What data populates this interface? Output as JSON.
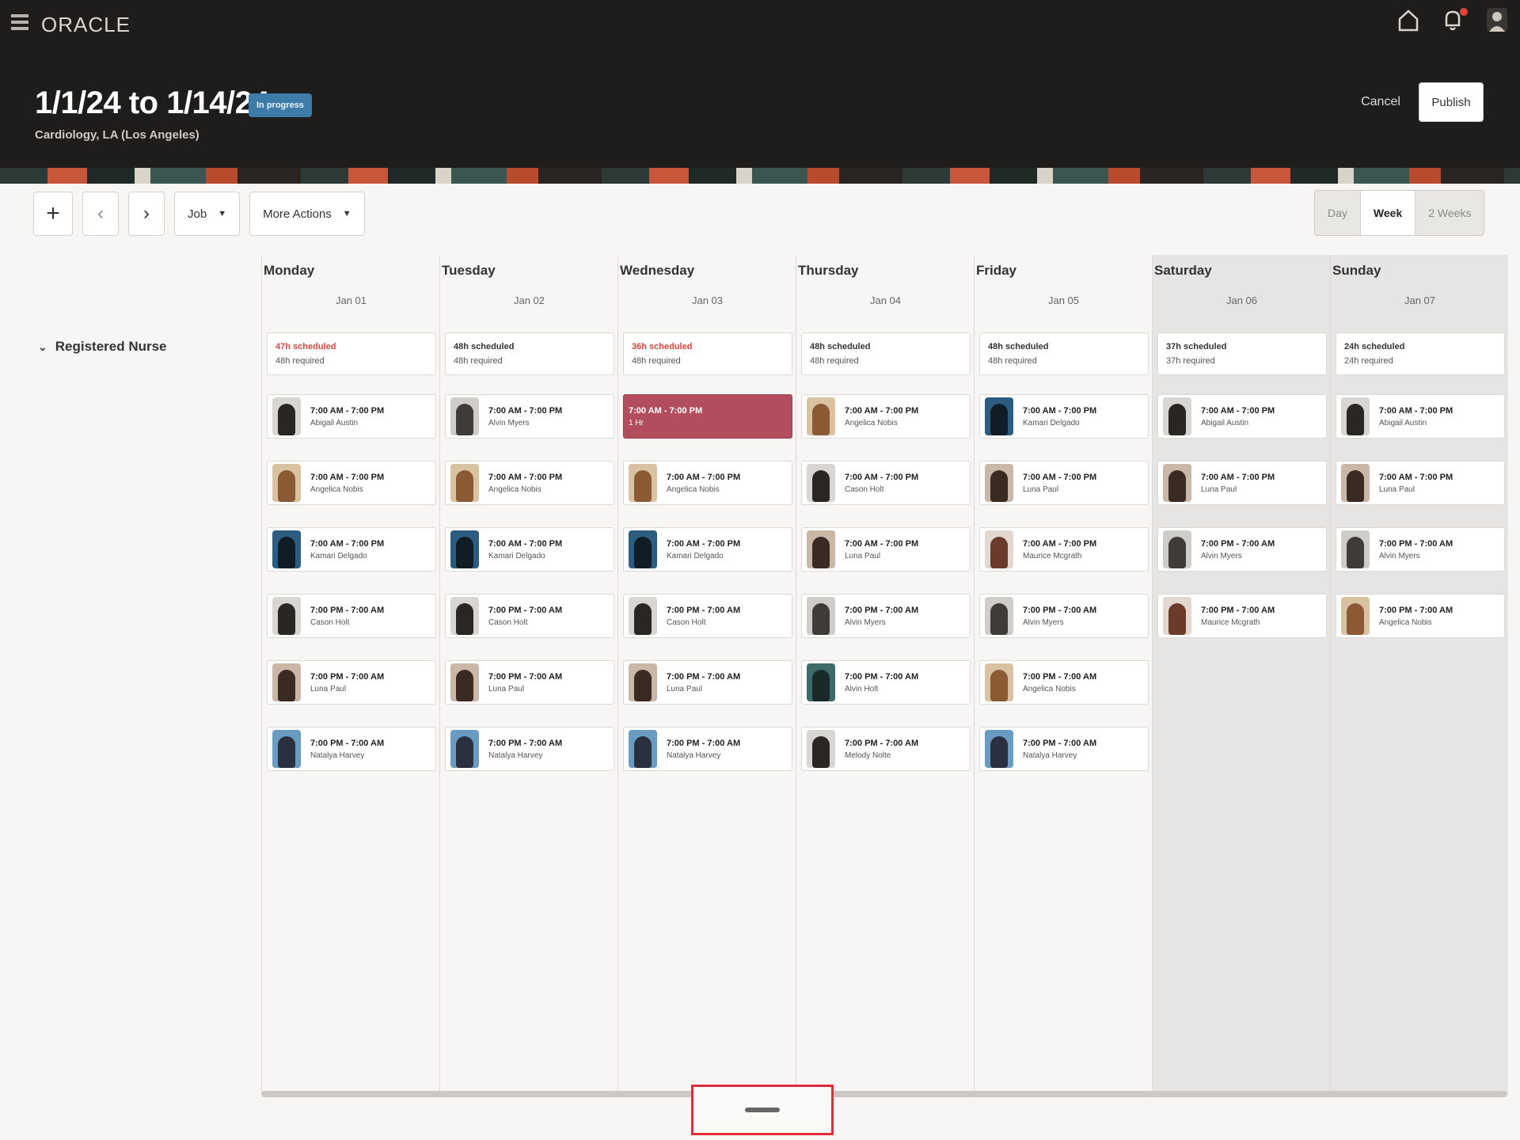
{
  "header": {
    "logo": "ORACLE",
    "title": "1/1/24 to 1/14/24",
    "status": "In progress",
    "subtitle": "Cardiology, LA (Los Angeles)",
    "cancel_label": "Cancel",
    "publish_label": "Publish",
    "icons": [
      "menu-icon",
      "home-icon",
      "notifications-icon",
      "user-avatar"
    ]
  },
  "toolbar": {
    "add_label": "+",
    "prev_label": "‹",
    "next_label": "›",
    "job_label": "Job",
    "more_actions_label": "More Actions",
    "views": [
      "Day",
      "Week",
      "2 Weeks"
    ],
    "active_view": "Week"
  },
  "group": {
    "label": "Registered Nurse"
  },
  "days": [
    {
      "name": "Monday",
      "date": "Jan 01",
      "scheduled": "47h scheduled",
      "required": "48h required",
      "warn": true,
      "weekend": false
    },
    {
      "name": "Tuesday",
      "date": "Jan 02",
      "scheduled": "48h scheduled",
      "required": "48h required",
      "warn": false,
      "weekend": false
    },
    {
      "name": "Wednesday",
      "date": "Jan 03",
      "scheduled": "36h scheduled",
      "required": "48h required",
      "warn": true,
      "weekend": false
    },
    {
      "name": "Thursday",
      "date": "Jan 04",
      "scheduled": "48h scheduled",
      "required": "48h required",
      "warn": false,
      "weekend": false
    },
    {
      "name": "Friday",
      "date": "Jan 05",
      "scheduled": "48h scheduled",
      "required": "48h required",
      "warn": false,
      "weekend": false
    },
    {
      "name": "Saturday",
      "date": "Jan 06",
      "scheduled": "37h scheduled",
      "required": "37h required",
      "warn": false,
      "weekend": true
    },
    {
      "name": "Sunday",
      "date": "Jan 07",
      "scheduled": "24h scheduled",
      "required": "24h required",
      "warn": false,
      "weekend": true
    }
  ],
  "shifts": [
    [
      {
        "time": "7:00 AM - 7:00 PM",
        "person": "Abigail Austin",
        "avatar": "dark"
      },
      {
        "time": "7:00 AM - 7:00 PM",
        "person": "Angelica Nobis",
        "avatar": "warm"
      },
      {
        "time": "7:00 AM - 7:00 PM",
        "person": "Kamari Delgado",
        "avatar": "blue"
      },
      {
        "time": "7:00 PM - 7:00 AM",
        "person": "Cason Holt",
        "avatar": "dark"
      },
      {
        "time": "7:00 PM - 7:00 AM",
        "person": "Luna Paul",
        "avatar": "brown"
      },
      {
        "time": "7:00 PM - 7:00 AM",
        "person": "Natalya Harvey",
        "avatar": "navy"
      }
    ],
    [
      {
        "time": "7:00 AM - 7:00 PM",
        "person": "Alvin Myers",
        "avatar": "grey"
      },
      {
        "time": "7:00 AM - 7:00 PM",
        "person": "Angelica Nobis",
        "avatar": "warm"
      },
      {
        "time": "7:00 AM - 7:00 PM",
        "person": "Kamari Delgado",
        "avatar": "blue"
      },
      {
        "time": "7:00 PM - 7:00 AM",
        "person": "Cason Holt",
        "avatar": "dark"
      },
      {
        "time": "7:00 PM - 7:00 AM",
        "person": "Luna Paul",
        "avatar": "brown"
      },
      {
        "time": "7:00 PM - 7:00 AM",
        "person": "Natalya Harvey",
        "avatar": "navy"
      }
    ],
    [
      {
        "time": "7:00 AM - 7:00 PM",
        "person": "1 Hr",
        "avatar": "",
        "open": true
      },
      {
        "time": "7:00 AM - 7:00 PM",
        "person": "Angelica Nobis",
        "avatar": "warm"
      },
      {
        "time": "7:00 AM - 7:00 PM",
        "person": "Kamari Delgado",
        "avatar": "blue"
      },
      {
        "time": "7:00 PM - 7:00 AM",
        "person": "Cason Holt",
        "avatar": "dark"
      },
      {
        "time": "7:00 PM - 7:00 AM",
        "person": "Luna Paul",
        "avatar": "brown"
      },
      {
        "time": "7:00 PM - 7:00 AM",
        "person": "Natalya Harvey",
        "avatar": "navy"
      }
    ],
    [
      {
        "time": "7:00 AM - 7:00 PM",
        "person": "Angelica Nobis",
        "avatar": "warm"
      },
      {
        "time": "7:00 AM - 7:00 PM",
        "person": "Cason Holt",
        "avatar": "dark"
      },
      {
        "time": "7:00 AM - 7:00 PM",
        "person": "Luna Paul",
        "avatar": "brown"
      },
      {
        "time": "7:00 PM - 7:00 AM",
        "person": "Alvin Myers",
        "avatar": "grey"
      },
      {
        "time": "7:00 PM - 7:00 AM",
        "person": "Alvin Holt",
        "avatar": "teal"
      },
      {
        "time": "7:00 PM - 7:00 AM",
        "person": "Melody Nolte",
        "avatar": "dark"
      }
    ],
    [
      {
        "time": "7:00 AM - 7:00 PM",
        "person": "Kamari Delgado",
        "avatar": "blue"
      },
      {
        "time": "7:00 AM - 7:00 PM",
        "person": "Luna Paul",
        "avatar": "brown"
      },
      {
        "time": "7:00 AM - 7:00 PM",
        "person": "Maurice Mcgrath",
        "avatar": "rust"
      },
      {
        "time": "7:00 PM - 7:00 AM",
        "person": "Alvin Myers",
        "avatar": "grey"
      },
      {
        "time": "7:00 PM - 7:00 AM",
        "person": "Angelica Nobis",
        "avatar": "warm"
      },
      {
        "time": "7:00 PM - 7:00 AM",
        "person": "Natalya Harvey",
        "avatar": "navy"
      }
    ],
    [
      {
        "time": "7:00 AM - 7:00 PM",
        "person": "Abigail Austin",
        "avatar": "dark"
      },
      {
        "time": "7:00 AM - 7:00 PM",
        "person": "Luna Paul",
        "avatar": "brown"
      },
      {
        "time": "7:00 PM - 7:00 AM",
        "person": "Alvin Myers",
        "avatar": "grey"
      },
      {
        "time": "7:00 PM - 7:00 AM",
        "person": "Maurice Mcgrath",
        "avatar": "rust"
      }
    ],
    [
      {
        "time": "7:00 AM - 7:00 PM",
        "person": "Abigail Austin",
        "avatar": "dark"
      },
      {
        "time": "7:00 AM - 7:00 PM",
        "person": "Luna Paul",
        "avatar": "brown"
      },
      {
        "time": "7:00 PM - 7:00 AM",
        "person": "Alvin Myers",
        "avatar": "grey"
      },
      {
        "time": "7:00 PM - 7:00 AM",
        "person": "Angelica Nobis",
        "avatar": "warm"
      }
    ]
  ],
  "colors": {
    "header_bg": "#1f1d1b",
    "open_shift": "#b24d5e",
    "warn_text": "#d0473e",
    "highlight_border": "#e02b3a",
    "weekend_bg": "#e6e5e3"
  },
  "avatar_colors": {
    "dark": [
      "#d8d6d2",
      "#2a2623"
    ],
    "warm": [
      "#d9c2a2",
      "#8a5a34"
    ],
    "blue": [
      "#2c5c80",
      "#101c26"
    ],
    "brown": [
      "#c9b8a8",
      "#3a2a22"
    ],
    "navy": [
      "#6a9bc0",
      "#2a3040"
    ],
    "grey": [
      "#cfcdca",
      "#3e3b38"
    ],
    "teal": [
      "#3e6a6a",
      "#1a2a2a"
    ],
    "rust": [
      "#e2d8d0",
      "#6a3a2a"
    ]
  }
}
